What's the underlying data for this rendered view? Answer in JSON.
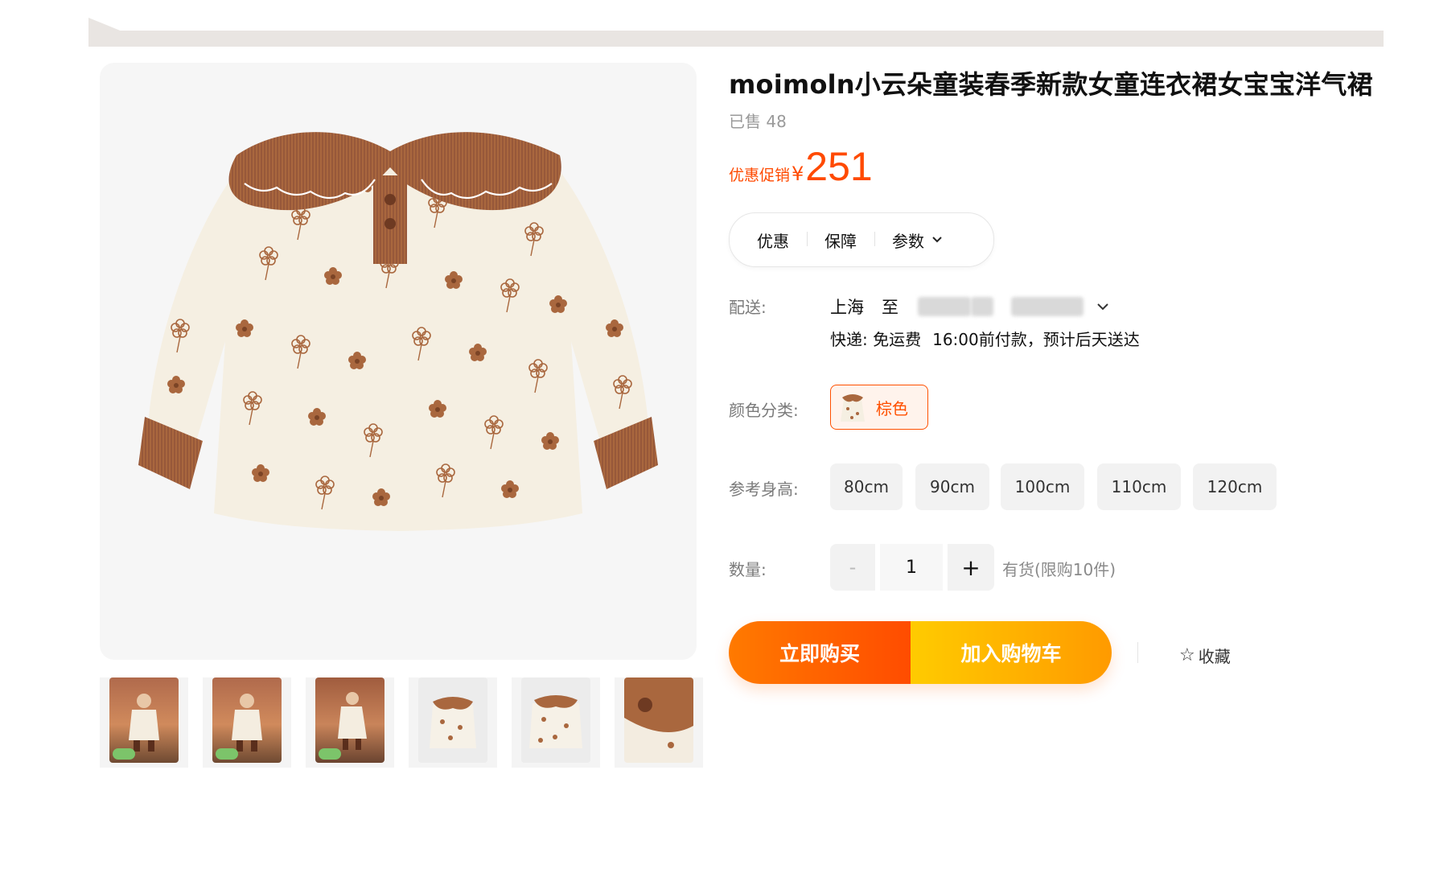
{
  "product": {
    "title": "moimoln小云朵童装春季新款女童连衣裙女宝宝洋气裙",
    "sold_text": "已售 48",
    "price_label": "优惠促销",
    "price_symbol": "¥",
    "price_value": "251"
  },
  "info_tabs": [
    {
      "label": "优惠"
    },
    {
      "label": "保障"
    },
    {
      "label": "参数",
      "icon": "chevron-down-icon"
    }
  ],
  "delivery": {
    "label": "配送:",
    "from": "上海",
    "to_word": "至",
    "express": "快递: 免运费",
    "eta": "16:00前付款，预计后天送达"
  },
  "color": {
    "label": "颜色分类:",
    "options": [
      {
        "label": "棕色",
        "selected": true
      }
    ]
  },
  "size": {
    "label": "参考身高:",
    "options": [
      "80cm",
      "90cm",
      "100cm",
      "110cm",
      "120cm"
    ]
  },
  "quantity": {
    "label": "数量:",
    "minus": "-",
    "value": "1",
    "plus": "+",
    "stock": "有货(限购10件)"
  },
  "actions": {
    "buy_now": "立即购买",
    "add_cart": "加入购物车",
    "favorite": "收藏"
  },
  "colors": {
    "accent": "#ff5000",
    "price": "#ff4a00",
    "dress_cream": "#f5efe2",
    "dress_brown": "#a9673e"
  },
  "thumbnails": [
    {
      "type": "photo-forest"
    },
    {
      "type": "photo-forest"
    },
    {
      "type": "photo-forest-side"
    },
    {
      "type": "product-white"
    },
    {
      "type": "product-white"
    },
    {
      "type": "closeup-collar"
    }
  ]
}
